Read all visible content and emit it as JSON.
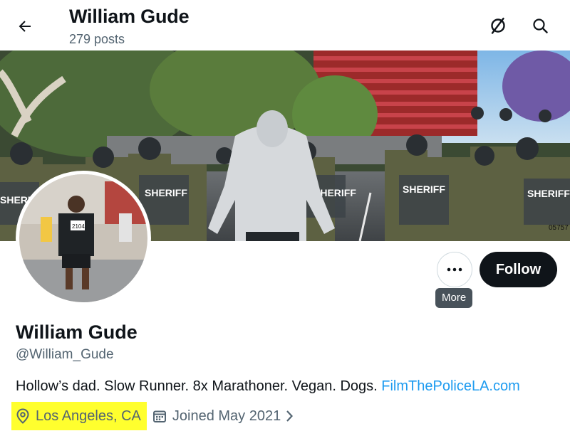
{
  "header": {
    "title": "William Gude",
    "posts": "279 posts",
    "icons": [
      "back-arrow-icon",
      "grok-icon",
      "search-icon"
    ]
  },
  "banner": {
    "labels": [
      "SHERIFF",
      "SHERIFF",
      "SHERIFF",
      "SHERIFF",
      "SHERIFF"
    ],
    "vehicle_number": "05757",
    "bib_number": "2104"
  },
  "actions": {
    "more_tooltip": "More",
    "follow_label": "Follow"
  },
  "profile": {
    "display_name": "William Gude",
    "handle": "@William_Gude",
    "bio_text": "Hollow’s dad. Slow Runner. 8x Marathoner. Vegan. Dogs. ",
    "bio_link": "FilmThePoliceLA.com",
    "location": "Los Angeles, CA",
    "joined": "Joined May 2021"
  },
  "colors": {
    "link": "#1d9bf0",
    "highlight": "#ffff2e",
    "secondary_text": "#536471",
    "follow_bg": "#0f1419",
    "tooltip_bg": "#48525a"
  }
}
